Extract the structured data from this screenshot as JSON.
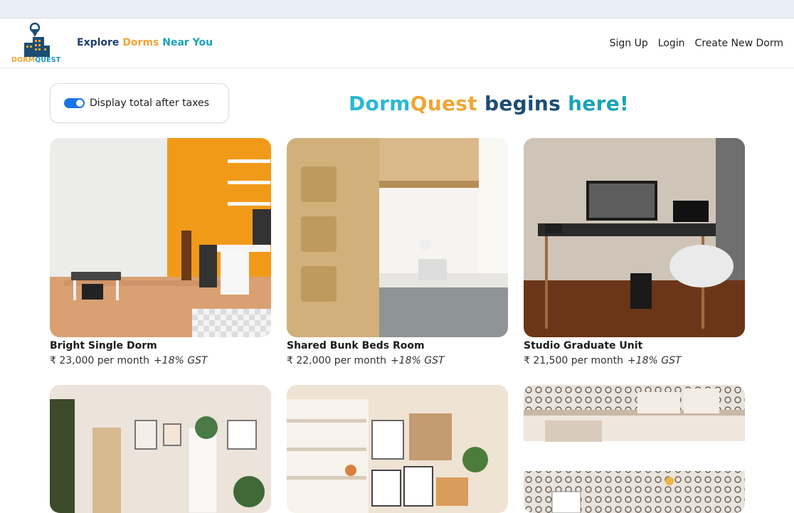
{
  "navbar": {
    "logo_part1": "DORM",
    "logo_part2": "QUEST",
    "explore_1": "Explore ",
    "explore_2": "Dorms",
    "explore_3": " Near You",
    "links": [
      "Sign Up",
      "Login",
      "Create New Dorm"
    ]
  },
  "toggle": {
    "label": "Display total after taxes",
    "checked": true
  },
  "headline": {
    "part1": "Dorm",
    "part2": "Quest",
    "part3": " begins",
    "part4": " here!"
  },
  "listings": [
    {
      "title": "Bright Single Dorm",
      "price": "₹ 23,000 per month",
      "gst": "+18% GST"
    },
    {
      "title": "Shared Bunk Beds Room",
      "price": "₹ 22,000 per month",
      "gst": "+18% GST"
    },
    {
      "title": "Studio Graduate Unit",
      "price": "₹ 21,500 per month",
      "gst": "+18% GST"
    },
    {
      "title": "",
      "price": "",
      "gst": ""
    },
    {
      "title": "",
      "price": "",
      "gst": ""
    },
    {
      "title": "",
      "price": "",
      "gst": ""
    }
  ],
  "colors": {
    "brand_orange": "#f0a535",
    "brand_teal": "#1aa3b9",
    "brand_navy": "#1c4d74",
    "toggle_blue": "#1a73e8"
  }
}
